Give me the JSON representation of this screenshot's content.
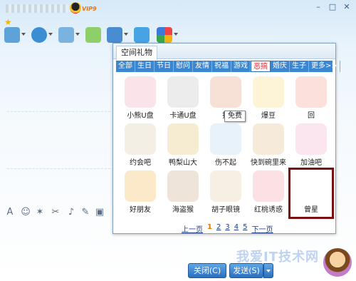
{
  "window": {
    "vip_badge": "VIP9"
  },
  "toolbar_icons": [
    "video-call-icon",
    "camera-icon",
    "file-transfer-icon",
    "add-contact-icon",
    "screen-share-icon",
    "remote-desktop-icon",
    "apps-grid-icon"
  ],
  "buttons": {
    "close": "关闭(C)",
    "send": "发送(S)"
  },
  "watermark": "我爱IT技术网",
  "popup": {
    "title": "空间礼物",
    "categories": [
      "全部",
      "生日",
      "节日",
      "慰问",
      "友情",
      "祝福",
      "游戏",
      "恶搞",
      "婚庆",
      "生子",
      "更多>>"
    ],
    "active_category": "恶搞",
    "tooltip": "免费",
    "items": [
      {
        "label": "小熊U盘",
        "bg": "#fbe3ea"
      },
      {
        "label": "卡通U盘",
        "bg": "#ececec"
      },
      {
        "label": "打",
        "bg": "#f7e0d6"
      },
      {
        "label": "爆豆",
        "bg": "#fdf3d6"
      },
      {
        "label": "回",
        "bg": "#fbe0dc"
      },
      {
        "label": "约会吧",
        "bg": "#f4efe4"
      },
      {
        "label": "鸭梨山大",
        "bg": "#f5ecd2"
      },
      {
        "label": "伤不起",
        "bg": "#e8f2fb"
      },
      {
        "label": "快到碗里来",
        "bg": "#f6eadb"
      },
      {
        "label": "加油吧",
        "bg": "#fbe6ef"
      },
      {
        "label": "好朋友",
        "bg": "#fce9c9"
      },
      {
        "label": "海盗猴",
        "bg": "#efe4da"
      },
      {
        "label": "胡子眼镜",
        "bg": "#f7efe4"
      },
      {
        "label": "红桃诱惑",
        "bg": "#fbe1e4"
      },
      {
        "label": "曾星",
        "bg": "#ffffff"
      }
    ],
    "pager": {
      "prev": "上一页",
      "pages": [
        "1",
        "2",
        "3",
        "4",
        "5"
      ],
      "current": "1",
      "next": "下一页"
    }
  }
}
